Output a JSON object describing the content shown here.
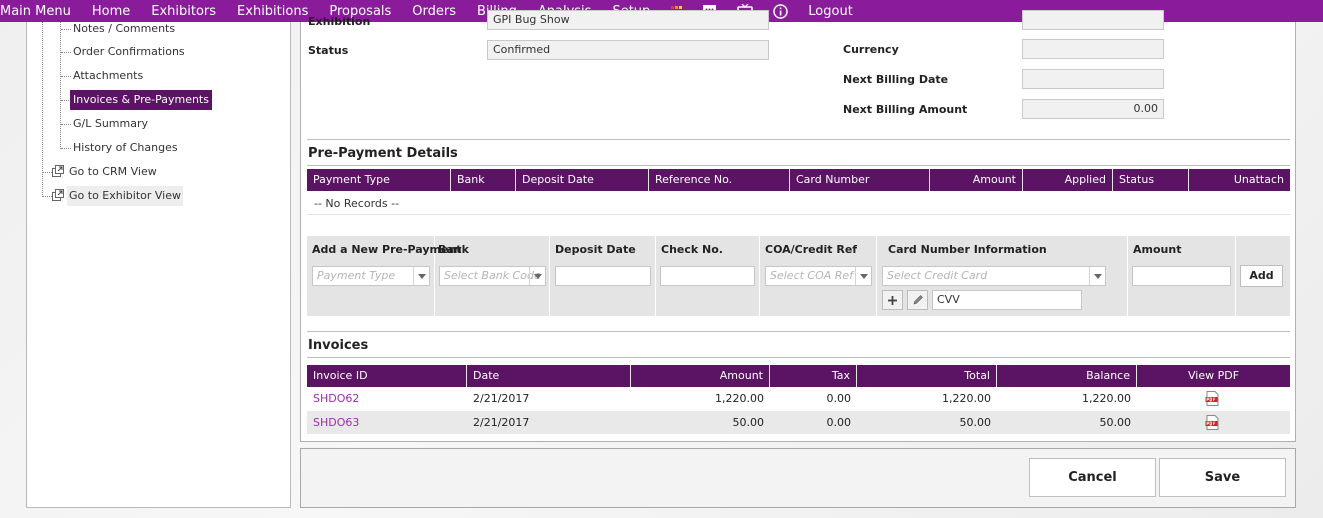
{
  "top_menu": {
    "items": [
      "Main Menu",
      "Home",
      "Exhibitors",
      "Exhibitions",
      "Proposals",
      "Orders",
      "Billing",
      "Analysis",
      "Setup"
    ],
    "icons": [
      "apps-grid-icon",
      "chat-icon",
      "media-icon",
      "info-icon"
    ],
    "logout": "Logout",
    "brand_color": "#8a1c9c"
  },
  "sidebar": {
    "items": [
      {
        "label": "Notes / Comments"
      },
      {
        "label": "Order Confirmations"
      },
      {
        "label": "Attachments"
      },
      {
        "label": "Invoices & Pre-Payments"
      },
      {
        "label": "G/L Summary"
      },
      {
        "label": "History of Changes"
      },
      {
        "label": "Go to CRM View"
      },
      {
        "label": "Go to Exhibitor View"
      }
    ]
  },
  "details": {
    "exhibition_label": "Exhibition",
    "exhibition_value": "GPI Bug Show",
    "status_label": "Status",
    "status_value": "Confirmed",
    "currency_label": "Currency",
    "currency_value": "",
    "next_billing_date_label": "Next Billing Date",
    "next_billing_date_value": "",
    "next_billing_amount_label": "Next Billing Amount",
    "next_billing_amount_value": "0.00"
  },
  "prepayment": {
    "title": "Pre-Payment Details",
    "columns": [
      "Payment Type",
      "Bank",
      "Deposit Date",
      "Reference No.",
      "Card Number",
      "Amount",
      "Applied",
      "Status",
      "Unattach"
    ],
    "no_records": "-- No Records --",
    "add_form": {
      "headers": [
        "Add a New Pre-Payment",
        "Bank",
        "Deposit Date",
        "Check No.",
        "COA/Credit Ref",
        "Card Number Information",
        "Amount"
      ],
      "payment_type_placeholder": "Payment Type",
      "bank_placeholder": "Select Bank Code",
      "coa_placeholder": "Select COA Ref",
      "card_placeholder": "Select Credit Card",
      "cvv_value": "CVV",
      "add_label": "Add"
    }
  },
  "invoices": {
    "title": "Invoices",
    "columns": [
      "Invoice ID",
      "Date",
      "Amount",
      "Tax",
      "Total",
      "Balance",
      "View PDF"
    ],
    "rows": [
      {
        "id": "SHDO62",
        "date": "2/21/2017",
        "amount": "1,220.00",
        "tax": "0.00",
        "total": "1,220.00",
        "balance": "1,220.00"
      },
      {
        "id": "SHDO63",
        "date": "2/21/2017",
        "amount": "50.00",
        "tax": "0.00",
        "total": "50.00",
        "balance": "50.00"
      }
    ]
  },
  "actions": {
    "cancel": "Cancel",
    "save": "Save"
  }
}
